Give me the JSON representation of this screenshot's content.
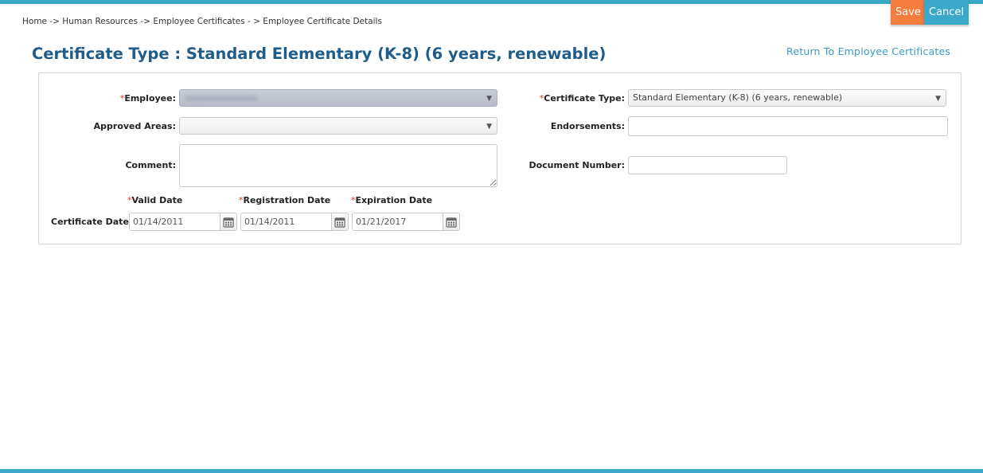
{
  "actions": {
    "save_label": "Save",
    "cancel_label": "Cancel"
  },
  "breadcrumb": "Home -> Human Resources -> Employee Certificates - > Employee Certificate Details",
  "page_title": "Certificate Type : Standard Elementary (K-8) (6 years, renewable)",
  "return_link": "Return To Employee Certificates",
  "form": {
    "required_marker": "*",
    "employee": {
      "label": "Employee:",
      "value": ""
    },
    "approved_areas": {
      "label": "Approved Areas:",
      "value": ""
    },
    "comment": {
      "label": "Comment:",
      "value": ""
    },
    "certificate_type": {
      "label": "Certificate Type:",
      "value": "Standard Elementary (K-8) (6 years, renewable)"
    },
    "endorsements": {
      "label": "Endorsements:",
      "value": ""
    },
    "document_number": {
      "label": "Document Number:",
      "value": ""
    },
    "certificate_dates": {
      "label": "Certificate Dates",
      "valid": {
        "label": "Valid Date",
        "value": "01/14/2011"
      },
      "registration": {
        "label": "Registration Date",
        "value": "01/14/2011"
      },
      "expiration": {
        "label": "Expiration Date",
        "value": "01/21/2017"
      }
    }
  },
  "icons": {
    "dropdown": "chevron-down-icon",
    "calendar": "calendar-icon"
  },
  "colors": {
    "accent": "#3aa8c8",
    "save": "#f47c3c",
    "title": "#1f5c8a",
    "link": "#3a9cc4",
    "required": "#d9302c"
  }
}
